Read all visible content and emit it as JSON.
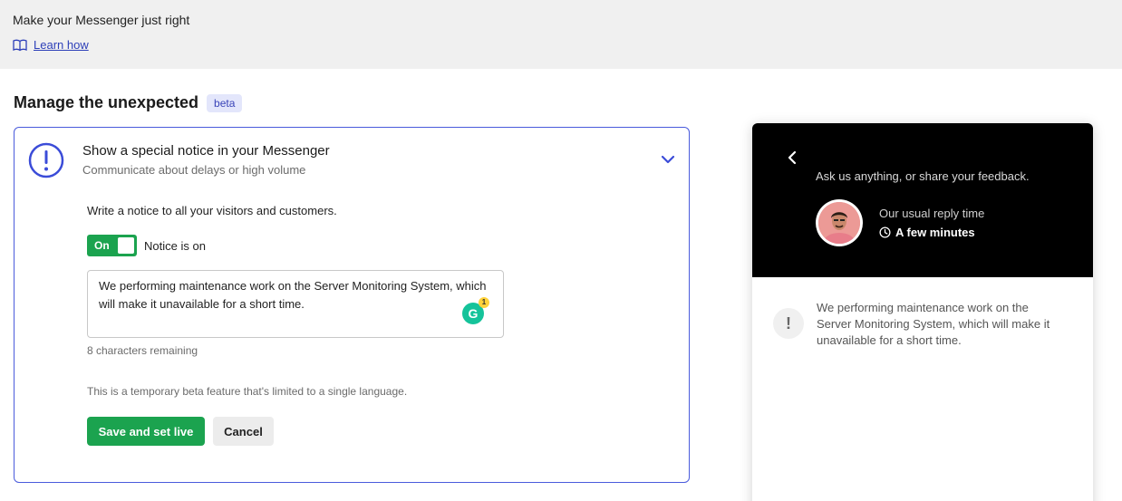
{
  "header": {
    "title": "Make your Messenger just right",
    "learn_link": "Learn how"
  },
  "section": {
    "title": "Manage the unexpected",
    "badge": "beta"
  },
  "card": {
    "title": "Show a special notice in your Messenger",
    "subtitle": "Communicate about delays or high volume",
    "intro": "Write a notice to all your visitors and customers.",
    "toggle_label": "On",
    "toggle_state": "Notice is on",
    "notice_text": "We performing maintenance work on the Server Monitoring System, which will make it unavailable for a short time.",
    "grammarly_count": "1",
    "remaining": "8 characters remaining",
    "disclaimer": "This is a temporary beta feature that's limited to a single language.",
    "save_label": "Save and set live",
    "cancel_label": "Cancel"
  },
  "preview": {
    "prompt": "Ask us anything, or share your feedback.",
    "reply_label": "Our usual reply time",
    "reply_time": "A few minutes",
    "notice_text": "We performing maintenance work on the Server Monitoring System, which will make it unavailable for a short time."
  },
  "colors": {
    "accent_blue": "#4a5bdc",
    "green": "#1ba34f",
    "messenger_header": "#000000"
  }
}
